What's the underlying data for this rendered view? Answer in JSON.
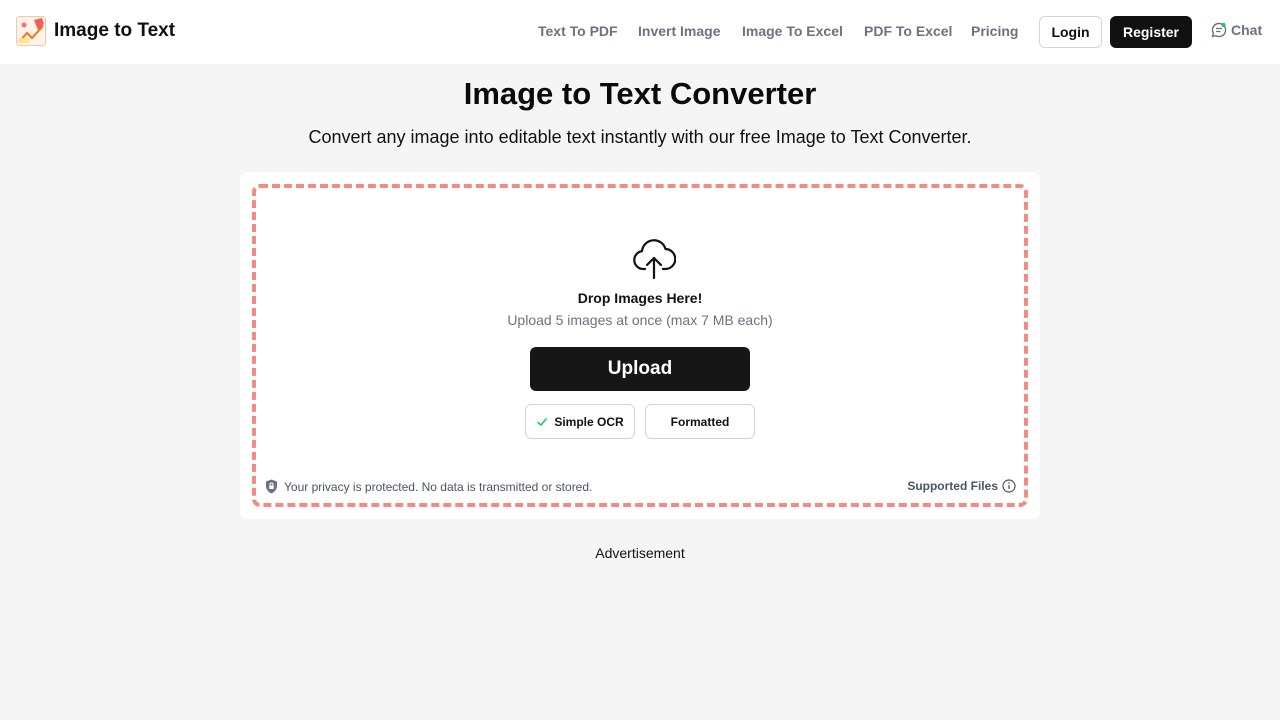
{
  "header": {
    "logo_text": "Image to Text",
    "nav": [
      "Text To PDF",
      "Invert Image",
      "Image To Excel",
      "PDF To Excel",
      "Pricing"
    ],
    "login_label": "Login",
    "register_label": "Register",
    "chat_label": "Chat"
  },
  "hero": {
    "title": "Image to Text Converter",
    "subtitle": "Convert any image into editable text instantly with our free Image to Text Converter."
  },
  "dropzone": {
    "icon": "cloud-upload-icon",
    "title": "Drop Images Here!",
    "subtitle": "Upload 5 images at once (max 7 MB each)",
    "upload_label": "Upload",
    "options": [
      {
        "label": "Simple OCR",
        "selected": true
      },
      {
        "label": "Formatted",
        "selected": false
      }
    ],
    "privacy_text": "Your privacy is protected. No data is transmitted or stored.",
    "supported_label": "Supported Files"
  },
  "ad_label": "Advertisement",
  "colors": {
    "accent_dashed": "#f28b82",
    "primary_button": "#161616",
    "check": "#22c55e",
    "muted_text": "#6b7280"
  }
}
